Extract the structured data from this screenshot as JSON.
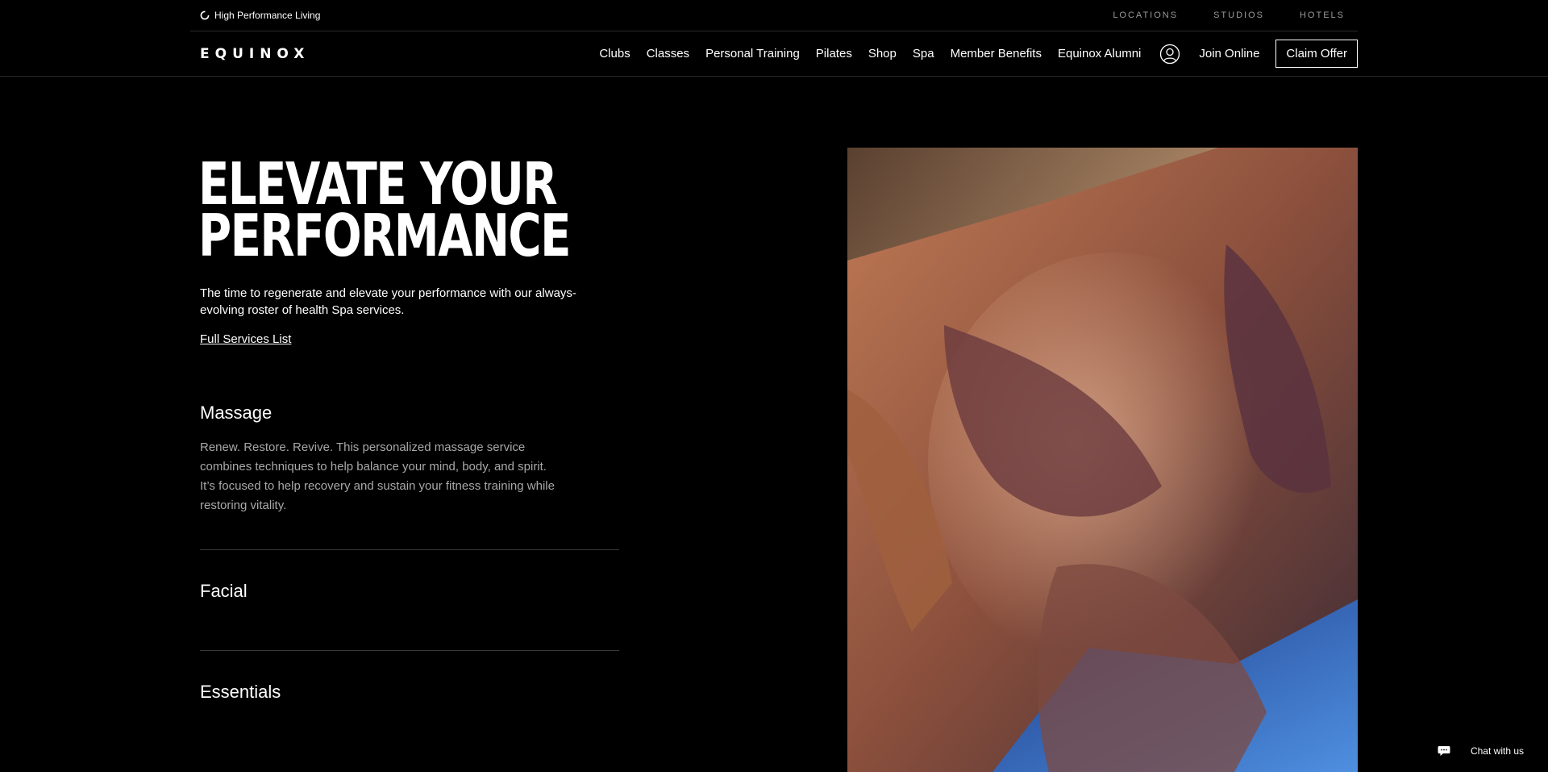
{
  "topbar": {
    "tagline": "High Performance Living",
    "utility_links": [
      "LOCATIONS",
      "STUDIOS",
      "HOTELS"
    ]
  },
  "header": {
    "logo": "EQUINOX",
    "nav": [
      "Clubs",
      "Classes",
      "Personal Training",
      "Pilates",
      "Shop",
      "Spa",
      "Member Benefits",
      "Equinox Alumni"
    ],
    "account_icon": "user-circle-icon",
    "join_label": "Join Online",
    "cta_label": "Claim Offer"
  },
  "hero": {
    "title_line1": "Elevate your",
    "title_line2": "Performance",
    "description": "The time to regenerate and elevate your performance with our always-evolving roster of health Spa services.",
    "link_label": "Full Services List"
  },
  "services": [
    {
      "title": "Massage",
      "body": "Renew. Restore. Revive. This personalized massage service combines techniques to help balance your mind, body, and spirit. It’s focused to help recovery and sustain your fitness training while restoring vitality."
    },
    {
      "title": "Facial"
    },
    {
      "title": "Essentials"
    }
  ],
  "chat": {
    "label": "Chat with us",
    "icon": "chat-bubble-icon"
  },
  "colors": {
    "background": "#000000",
    "text": "#ffffff",
    "muted": "#a8a8a8",
    "divider": "#3a3a3a"
  }
}
